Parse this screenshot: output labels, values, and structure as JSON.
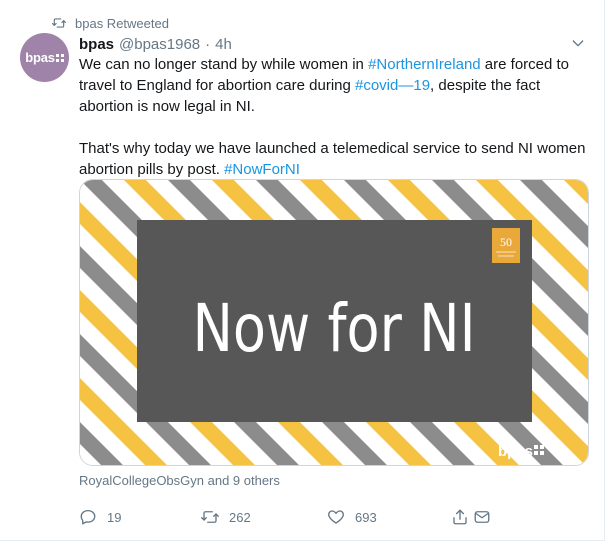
{
  "retweet": {
    "label": "bpas Retweeted"
  },
  "author": {
    "avatar_text": "bpas",
    "name": "bpas",
    "handle": "@bpas1968",
    "separator": "·",
    "time": "4h"
  },
  "tweet": {
    "para1": [
      {
        "text": "We can no longer stand by while women in ",
        "type": "text"
      },
      {
        "text": "#NorthernIreland",
        "type": "hashtag"
      },
      {
        "text": " are forced to travel to England for abortion care during ",
        "type": "text"
      },
      {
        "text": "#covid—19",
        "type": "hashtag"
      },
      {
        "text": ", despite the fact abortion is now legal in NI.",
        "type": "text"
      }
    ],
    "para2": [
      {
        "text": "That's why today we have launched a telemedical service to send NI women abortion pills by post. ",
        "type": "text"
      },
      {
        "text": "#NowForNI",
        "type": "hashtag"
      }
    ]
  },
  "media": {
    "headline": "Now for NI",
    "badge_number": "50",
    "logo_text": "bpas",
    "colors": {
      "stripe_yellow": "#f5c242",
      "stripe_grey": "#8c8c8c",
      "panel": "#575757",
      "badge": "#e8a83a"
    }
  },
  "liked_by": "RoyalCollegeObsGyn and 9 others",
  "actions": {
    "reply_count": "19",
    "retweet_count": "262",
    "like_count": "693"
  },
  "colors": {
    "link": "#1b95e0",
    "secondary": "#657786",
    "avatar": "#9f83a9"
  }
}
